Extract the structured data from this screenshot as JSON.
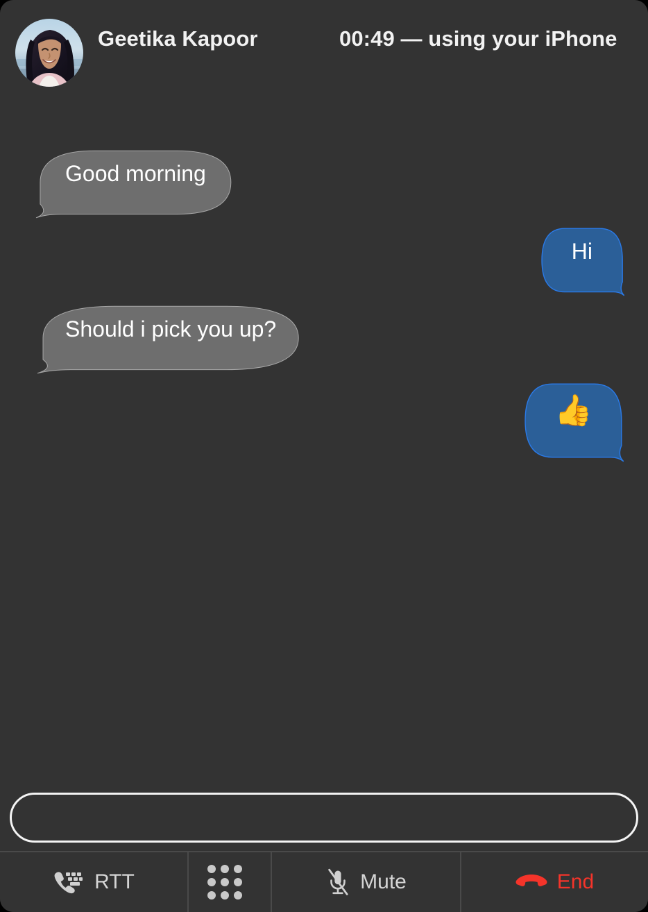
{
  "window": {
    "background_color": "#333333",
    "corner_radius_px": 19
  },
  "header": {
    "caller_name": "Geetika Kapoor",
    "status": "00:49 — using your iPhone",
    "duration": "00:49",
    "device_note": "using your iPhone",
    "avatar_alt": "Geetika Kapoor"
  },
  "transcript": {
    "messages": [
      {
        "sender": "incoming",
        "text": "Good morning",
        "type": "text"
      },
      {
        "sender": "outgoing",
        "text": "Hi",
        "type": "text"
      },
      {
        "sender": "incoming",
        "text": "Should i pick you up?",
        "type": "text"
      },
      {
        "sender": "outgoing",
        "text": "👍",
        "type": "emoji"
      }
    ]
  },
  "compose": {
    "value": "",
    "placeholder": ""
  },
  "toolbar": {
    "rtt_label": "RTT",
    "keypad_label": "",
    "mute_label": "Mute",
    "end_label": "End"
  },
  "colors": {
    "window_bg": "#333333",
    "incoming_bubble_fill": "#6e6e6e",
    "incoming_bubble_stroke": "#a8a8a8",
    "outgoing_bubble_fill": "#2b5f98",
    "outgoing_bubble_stroke": "#2a7ae8",
    "text_primary": "#f2f2f2",
    "toolbar_text": "#d4d4d4",
    "end_red": "#f5342a",
    "separator": "#4a4a4a",
    "compose_border": "#f4f4f4"
  }
}
